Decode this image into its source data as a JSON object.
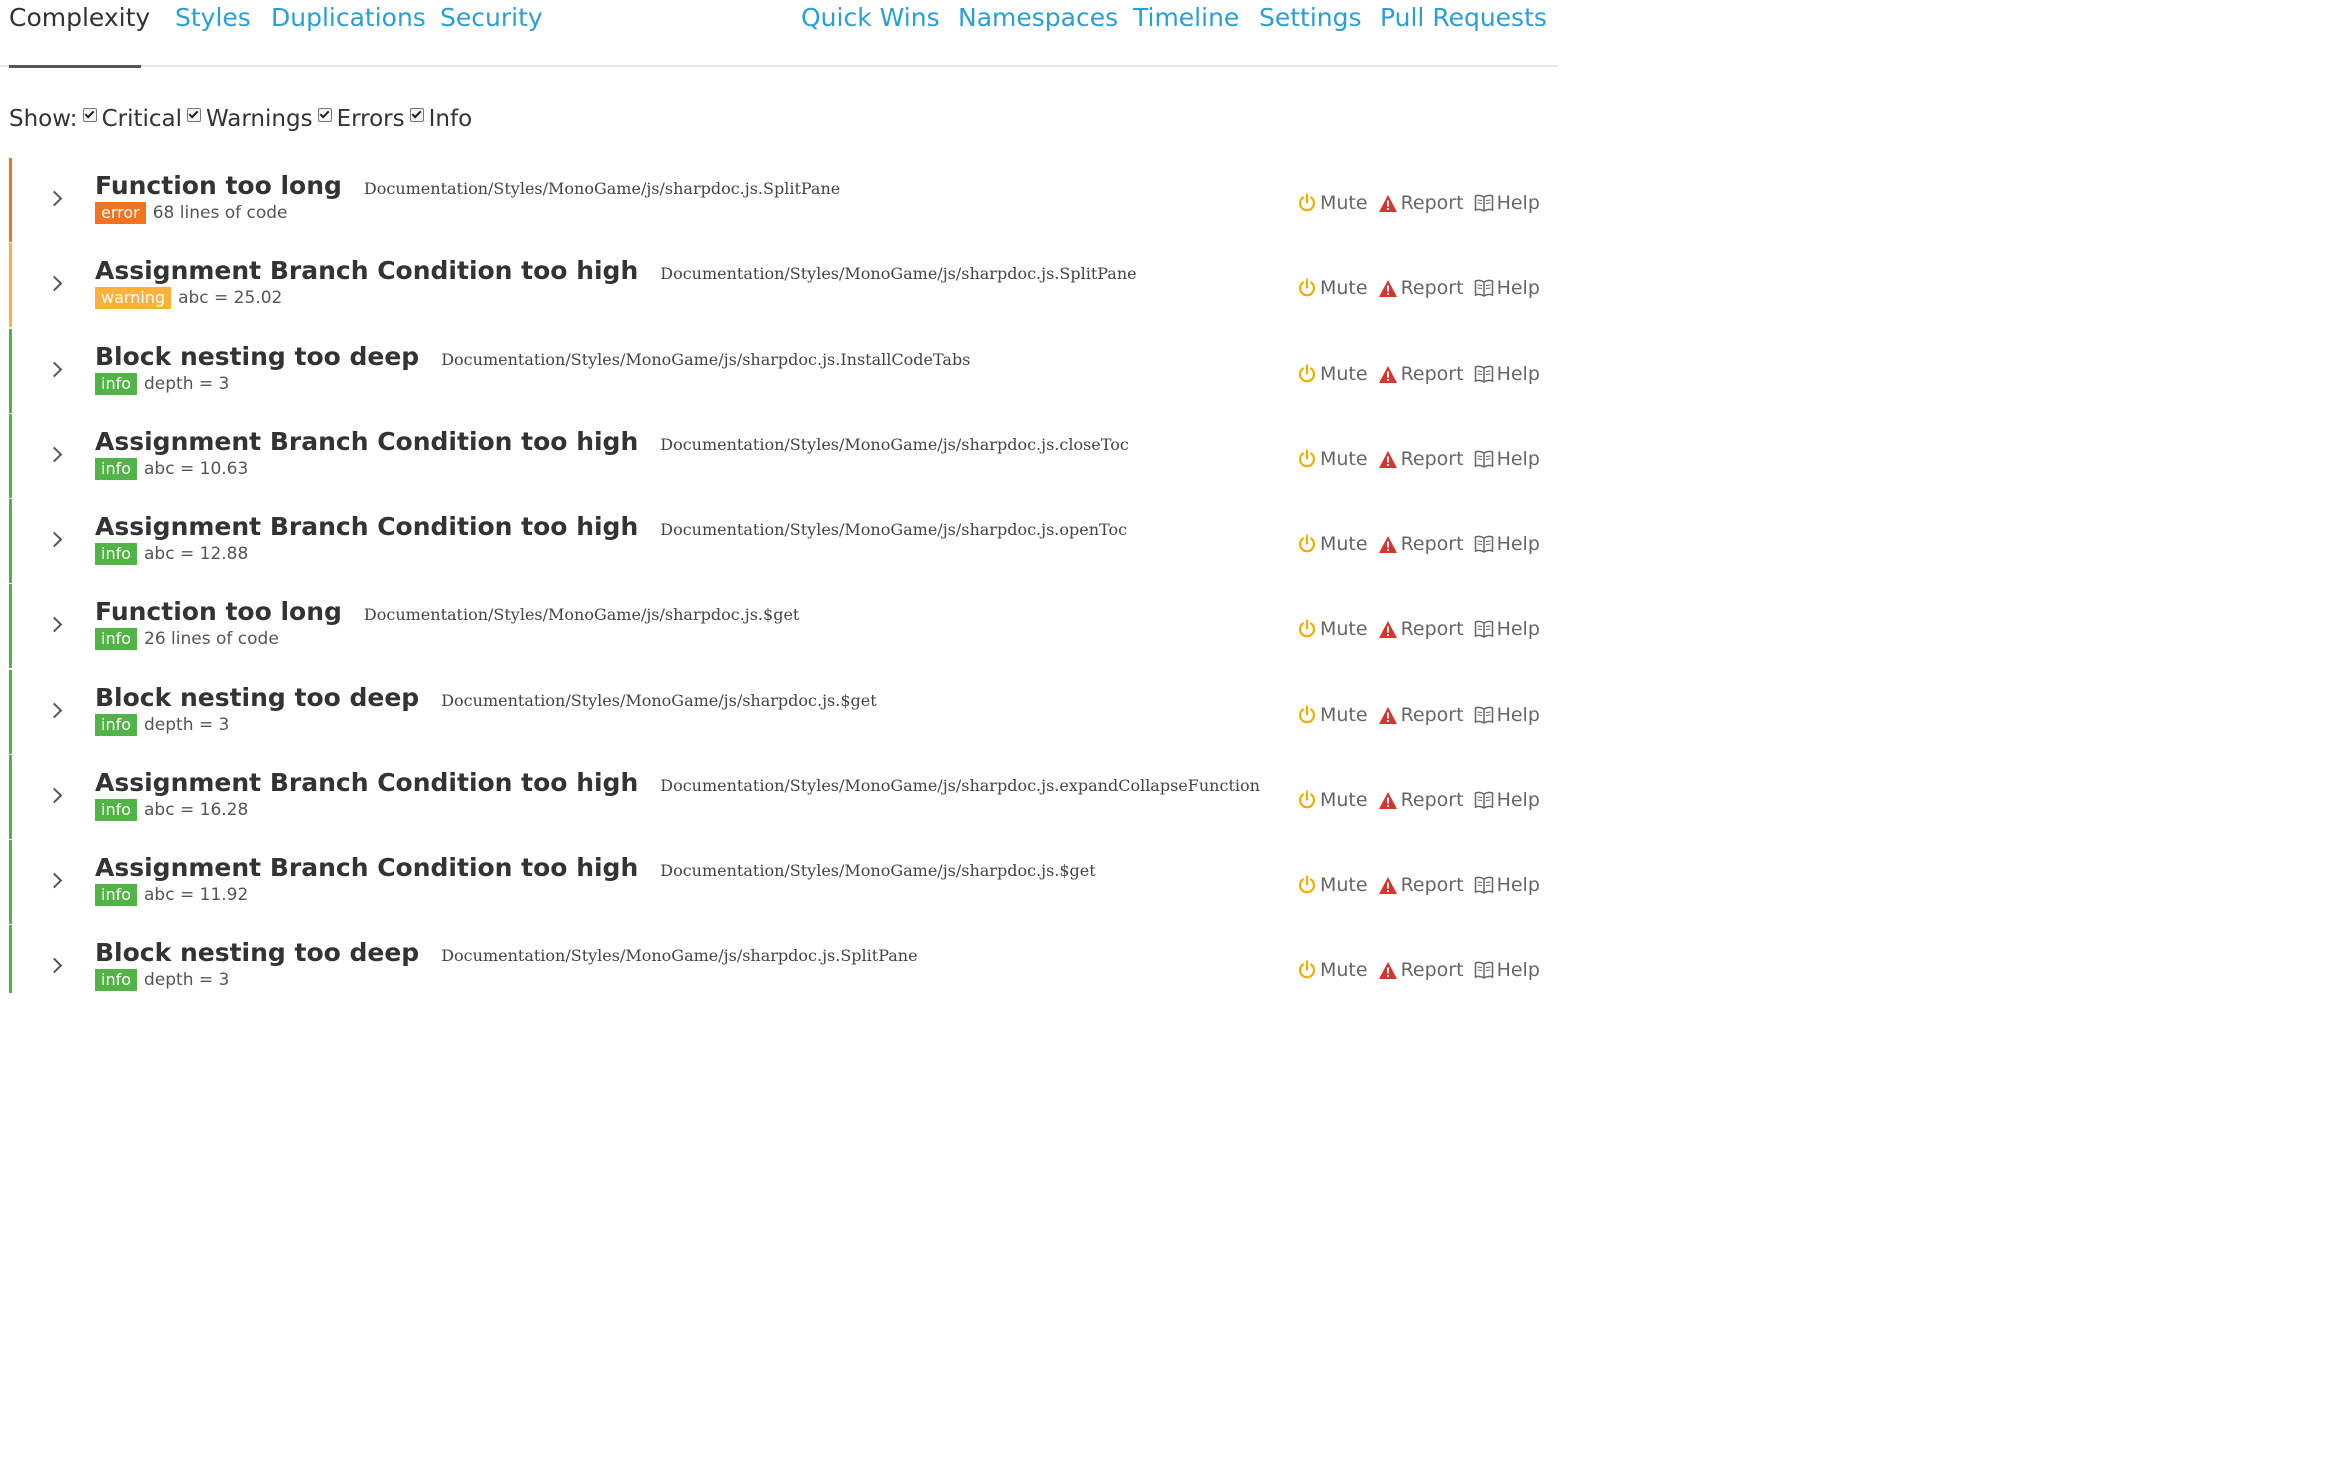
{
  "nav": {
    "tabs": [
      "Complexity",
      "Styles",
      "Duplications",
      "Security",
      "Quick Wins",
      "Namespaces",
      "Timeline",
      "Settings",
      "Pull Requests"
    ]
  },
  "filters": {
    "show_label": "Show:",
    "options": [
      {
        "label": "Critical",
        "checked": true
      },
      {
        "label": "Warnings",
        "checked": true
      },
      {
        "label": "Errors",
        "checked": true
      },
      {
        "label": "Info",
        "checked": true
      }
    ]
  },
  "actions": {
    "mute": "Mute",
    "report": "Report",
    "help": "Help"
  },
  "severity_colors": {
    "error": "#f47321",
    "warning": "#fbb13c",
    "info": "#52b346"
  },
  "issues": [
    {
      "title": "Function too long",
      "path": "Documentation/Styles/MonoGame/js/sharpdoc.js.SplitPane",
      "severity": "error",
      "metric": "68 lines of code"
    },
    {
      "title": "Assignment Branch Condition too high",
      "path": "Documentation/Styles/MonoGame/js/sharpdoc.js.SplitPane",
      "severity": "warning",
      "metric": "abc = 25.02"
    },
    {
      "title": "Block nesting too deep",
      "path": "Documentation/Styles/MonoGame/js/sharpdoc.js.InstallCodeTabs",
      "severity": "info",
      "metric": "depth = 3"
    },
    {
      "title": "Assignment Branch Condition too high",
      "path": "Documentation/Styles/MonoGame/js/sharpdoc.js.closeToc",
      "severity": "info",
      "metric": "abc = 10.63"
    },
    {
      "title": "Assignment Branch Condition too high",
      "path": "Documentation/Styles/MonoGame/js/sharpdoc.js.openToc",
      "severity": "info",
      "metric": "abc = 12.88"
    },
    {
      "title": "Function too long",
      "path": "Documentation/Styles/MonoGame/js/sharpdoc.js.$get",
      "severity": "info",
      "metric": "26 lines of code"
    },
    {
      "title": "Block nesting too deep",
      "path": "Documentation/Styles/MonoGame/js/sharpdoc.js.$get",
      "severity": "info",
      "metric": "depth = 3"
    },
    {
      "title": "Assignment Branch Condition too high",
      "path": "Documentation/Styles/MonoGame/js/sharpdoc.js.expandCollapseFunction",
      "severity": "info",
      "metric": "abc = 16.28"
    },
    {
      "title": "Assignment Branch Condition too high",
      "path": "Documentation/Styles/MonoGame/js/sharpdoc.js.$get",
      "severity": "info",
      "metric": "abc = 11.92"
    },
    {
      "title": "Block nesting too deep",
      "path": "Documentation/Styles/MonoGame/js/sharpdoc.js.SplitPane",
      "severity": "info",
      "metric": "depth = 3"
    }
  ]
}
